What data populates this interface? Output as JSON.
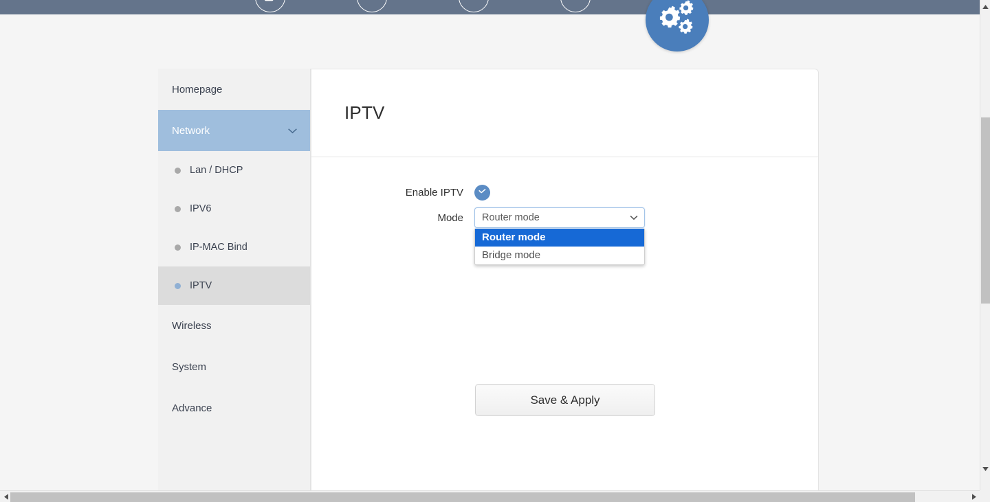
{
  "window": {
    "topbar_color": "#64748b",
    "accent_color": "#4a7ebb"
  },
  "topnav": {
    "items": [
      {
        "icon": "windows-stack-icon",
        "label": ""
      },
      {
        "icon": "grid-apps-icon",
        "label": ""
      },
      {
        "icon": "info-circle-icon",
        "label": ""
      },
      {
        "icon": "user-account-icon",
        "label": ""
      }
    ],
    "badge": {
      "icon": "gears-settings-icon",
      "label": ""
    }
  },
  "sidebar": {
    "items": [
      {
        "label": "Homepage",
        "type": "top",
        "state": "normal",
        "icon": ""
      },
      {
        "label": "Network",
        "type": "top",
        "state": "active-parent",
        "icon": "chevron-down-icon"
      },
      {
        "label": "Lan / DHCP",
        "type": "sub",
        "state": "normal",
        "icon": "bullet-dot-icon"
      },
      {
        "label": "IPV6",
        "type": "sub",
        "state": "normal",
        "icon": "bullet-dot-icon"
      },
      {
        "label": "IP-MAC Bind",
        "type": "sub",
        "state": "normal",
        "icon": "bullet-dot-icon"
      },
      {
        "label": "IPTV",
        "type": "sub",
        "state": "selected",
        "icon": "bullet-dot-icon"
      },
      {
        "label": "Wireless",
        "type": "top",
        "state": "normal",
        "icon": ""
      },
      {
        "label": "System",
        "type": "top",
        "state": "normal",
        "icon": ""
      },
      {
        "label": "Advance",
        "type": "top",
        "state": "normal",
        "icon": ""
      }
    ]
  },
  "main": {
    "title": "IPTV",
    "form": {
      "enable_label": "Enable IPTV",
      "enable_checked": true,
      "enable_icon": "check-circle-icon",
      "mode_label": "Mode",
      "mode_value": "Router mode",
      "mode_chevron_icon": "chevron-down-icon",
      "mode_options": [
        {
          "label": "Router mode",
          "highlighted": true
        },
        {
          "label": "Bridge mode",
          "highlighted": false
        }
      ]
    },
    "save_button": "Save & Apply"
  },
  "scrollbars": {
    "vertical": {
      "up_icon": "triangle-up-icon",
      "down_icon": "triangle-down-icon"
    },
    "horizontal": {
      "left_icon": "triangle-left-icon",
      "right_icon": "triangle-right-icon"
    }
  }
}
